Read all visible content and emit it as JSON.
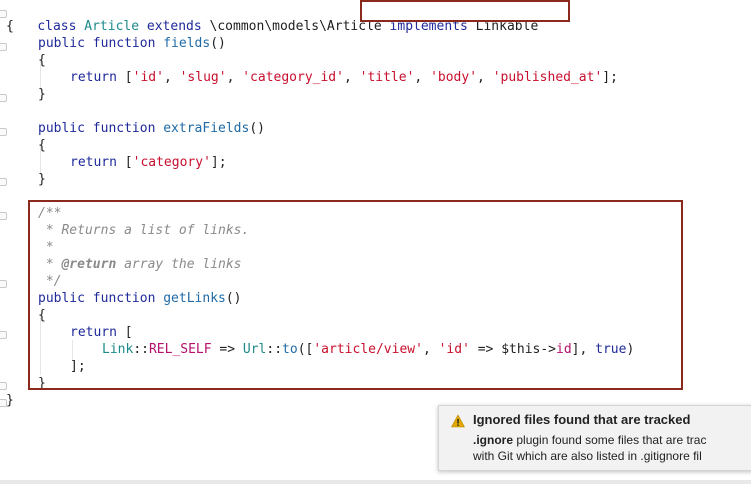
{
  "code": {
    "l1": {
      "kw1": "class ",
      "cls": "Article",
      "kw2": " extends ",
      "parent": "\\common\\models\\Article",
      "impl": "implements",
      "iface": " Linkable"
    },
    "l2": "{",
    "l3": {
      "kw": "public function ",
      "fn": "fields",
      "rest": "()"
    },
    "l4": "{",
    "l5": {
      "kw": "return ",
      "open": "[",
      "s1": "'id'",
      "s2": "'slug'",
      "s3": "'category_id'",
      "s4": "'title'",
      "s5": "'body'",
      "s6": "'published_at'",
      "close": "];",
      "sep": ", "
    },
    "l6": "}",
    "l8": {
      "kw": "public function ",
      "fn": "extraFields",
      "rest": "()"
    },
    "l9": "{",
    "l10": {
      "kw": "return ",
      "open": "[",
      "s1": "'category'",
      "close": "];"
    },
    "l11": "}",
    "l13": "/**",
    "l14": " * Returns a list of links.",
    "l15": " *",
    "l16": {
      "pre": " * ",
      "tag": "@return",
      "rest": " array the links"
    },
    "l17": " */",
    "l18": {
      "kw": "public function ",
      "fn": "getLinks",
      "rest": "()"
    },
    "l19": "{",
    "l20": {
      "kw": "return ",
      "rest": "["
    },
    "l21": {
      "cls1": "Link",
      "op1": "::",
      "const": "REL_SELF",
      "op2": " => ",
      "cls2": "Url",
      "op3": "::",
      "fn": "to",
      "open": "([",
      "s1": "'article/view'",
      "sep": ", ",
      "s2": "'id'",
      "op4": " => ",
      "var": "$this->",
      "prop": "id",
      "close": "], ",
      "kw": "true",
      "end": ")"
    },
    "l22": "];",
    "l23": "}",
    "l24": "}"
  },
  "notification": {
    "title": "Ignored files found that are tracked",
    "line1_bold": ".ignore",
    "line1_rest": " plugin found some files that are trac",
    "line2": "with Git which are also listed in .gitignore fil"
  },
  "colors": {
    "highlight_border": "#8b2a1c",
    "warning": "#e0a800"
  }
}
